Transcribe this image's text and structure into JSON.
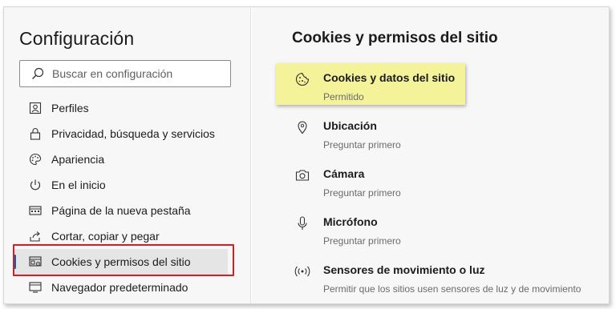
{
  "sidebar": {
    "title": "Configuración",
    "search": {
      "placeholder": "Buscar en configuración"
    },
    "items": [
      {
        "label": "Perfiles",
        "icon": "profile-icon"
      },
      {
        "label": "Privacidad, búsqueda y servicios",
        "icon": "lock-icon"
      },
      {
        "label": "Apariencia",
        "icon": "palette-icon"
      },
      {
        "label": "En el inicio",
        "icon": "power-icon"
      },
      {
        "label": "Página de la nueva pestaña",
        "icon": "new-tab-icon"
      },
      {
        "label": "Cortar, copiar y pegar",
        "icon": "share-icon"
      },
      {
        "label": "Cookies y permisos del sitio",
        "icon": "site-permissions-icon",
        "active": true
      },
      {
        "label": "Navegador predeterminado",
        "icon": "browser-icon"
      }
    ]
  },
  "main": {
    "title": "Cookies y permisos del sitio",
    "permissions": [
      {
        "name": "Cookies y datos del sitio",
        "status": "Permitido",
        "icon": "cookie-icon",
        "highlighted": true
      },
      {
        "name": "Ubicación",
        "status": "Preguntar primero",
        "icon": "location-pin-icon"
      },
      {
        "name": "Cámara",
        "status": "Preguntar primero",
        "icon": "camera-icon"
      },
      {
        "name": "Micrófono",
        "status": "Preguntar primero",
        "icon": "microphone-icon"
      },
      {
        "name": "Sensores de movimiento o luz",
        "status": "Permitir que los sitios usen sensores de luz y de movimiento",
        "icon": "sensor-icon"
      }
    ]
  },
  "colors": {
    "accent": "#0067c0",
    "highlight": "#f4f39a",
    "annotation_border": "#e0191f"
  }
}
